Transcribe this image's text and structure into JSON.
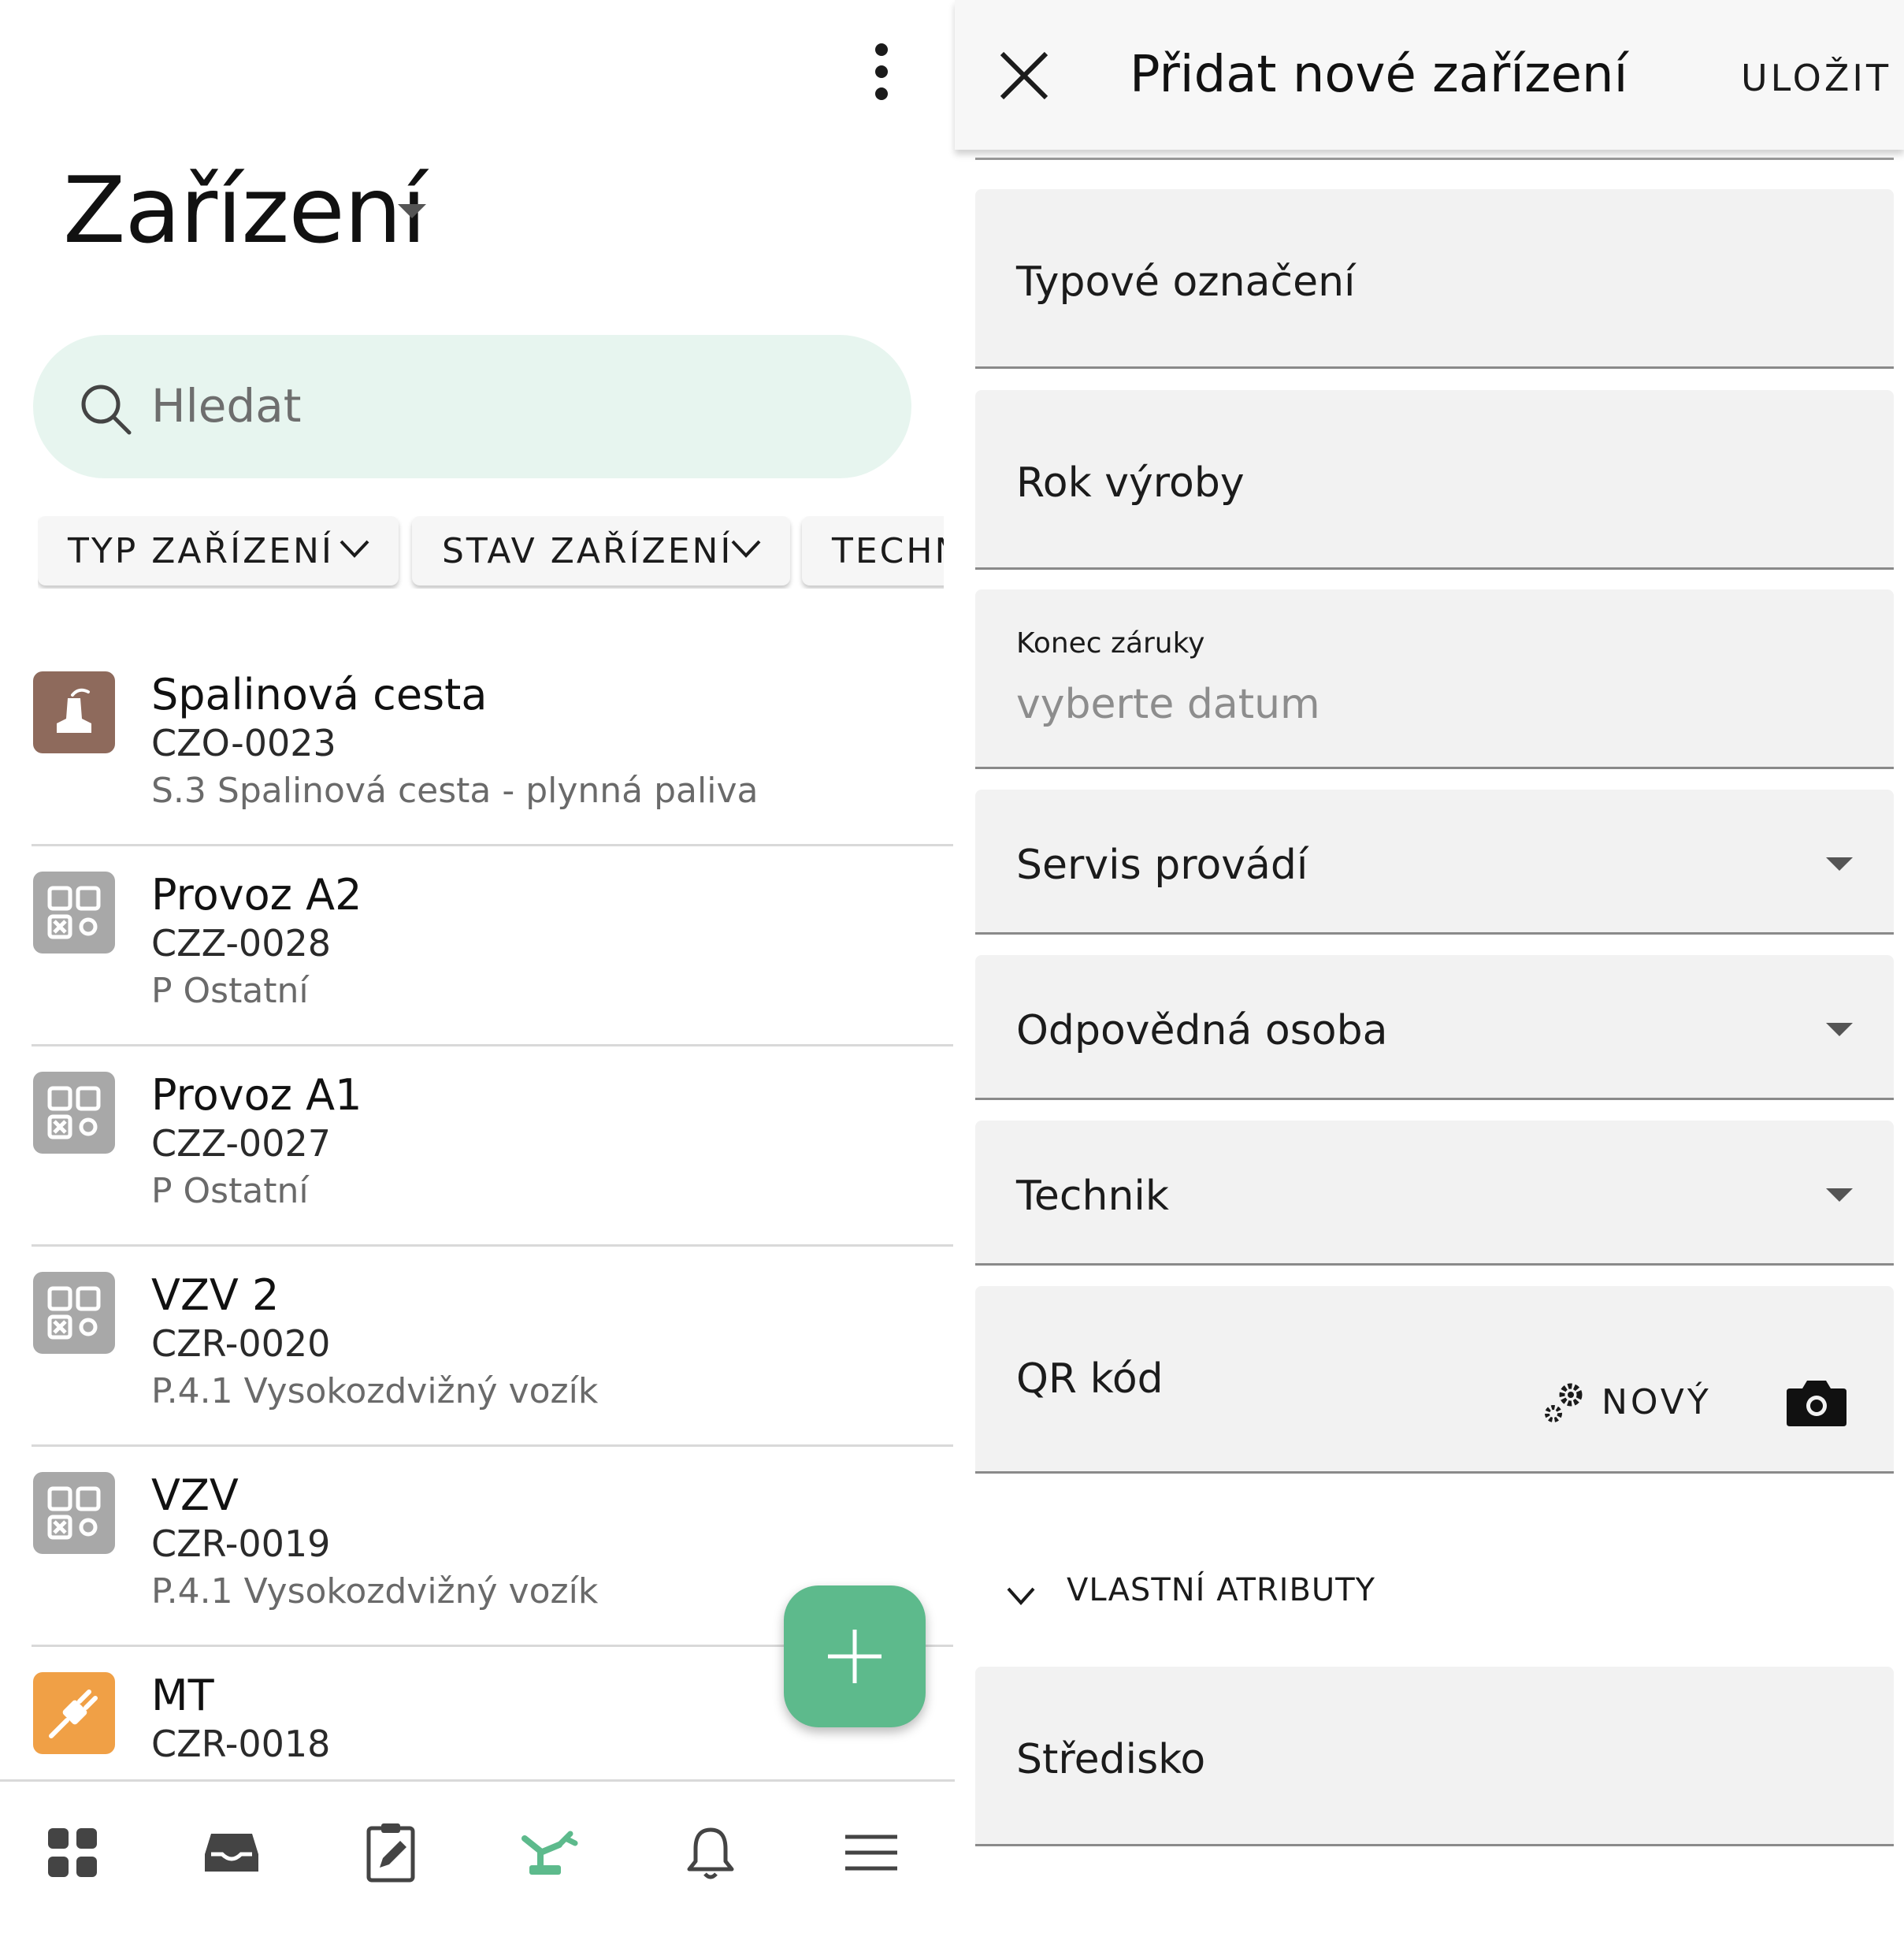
{
  "left": {
    "title": "Zařízení",
    "search": {
      "placeholder": "Hledat"
    },
    "filters": [
      "TYP ZAŘÍZENÍ",
      "STAV ZAŘÍZENÍ",
      "TECHN"
    ],
    "devices": [
      {
        "name": "Spalinová cesta",
        "code": "CZO-0023",
        "type": "S.3 Spalinová cesta - plynná paliva",
        "icon": "chimney-icon",
        "color": "#8e6a5c"
      },
      {
        "name": "Provoz A2",
        "code": "CZZ-0028",
        "type": "P Ostatní",
        "icon": "grid-icon",
        "color": "#a8a8a8"
      },
      {
        "name": "Provoz A1",
        "code": "CZZ-0027",
        "type": "P Ostatní",
        "icon": "grid-icon",
        "color": "#a8a8a8"
      },
      {
        "name": "VZV 2",
        "code": "CZR-0020",
        "type": "P.4.1 Vysokozdvižný vozík",
        "icon": "grid-icon",
        "color": "#a8a8a8"
      },
      {
        "name": "VZV",
        "code": "CZR-0019",
        "type": "P.4.1 Vysokozdvižný vozík",
        "icon": "grid-icon",
        "color": "#a8a8a8"
      },
      {
        "name": "MT",
        "code": "CZR-0018",
        "type": "",
        "icon": "plug-icon",
        "color": "#f0a046"
      }
    ],
    "nav": [
      "dashboard-icon",
      "inbox-icon",
      "clipboard-edit-icon",
      "devices-icon",
      "bell-icon",
      "menu-icon"
    ],
    "accent": "#5dba8c"
  },
  "form": {
    "title": "Přidat nové zařízení",
    "save": "ULOŽIT",
    "fields": {
      "type_designation": "Typové označení",
      "year": "Rok výroby",
      "warranty_label": "Konec záruky",
      "warranty_value": "vyberte datum",
      "service": "Servis provádí",
      "responsible": "Odpovědná osoba",
      "technician": "Technik",
      "qr": "QR kód",
      "qr_new": "NOVÝ"
    },
    "section": "VLASTNÍ ATRIBUTY",
    "center": "Středisko"
  }
}
